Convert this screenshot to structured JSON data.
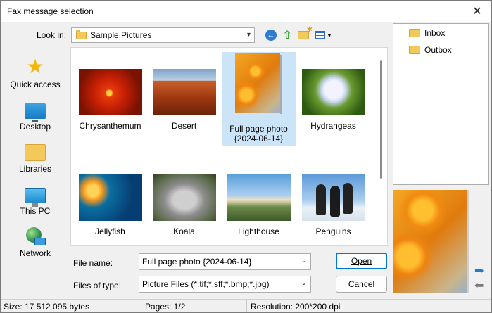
{
  "window": {
    "title": "Fax message selection"
  },
  "toolbar": {
    "look_in_label": "Look in:",
    "look_in_value": "Sample Pictures",
    "icons": [
      "back-icon",
      "up-folder-icon",
      "new-folder-icon",
      "views-menu-icon"
    ]
  },
  "places": [
    {
      "label": "Quick access",
      "icon": "star-icon"
    },
    {
      "label": "Desktop",
      "icon": "desktop-icon"
    },
    {
      "label": "Libraries",
      "icon": "libraries-icon"
    },
    {
      "label": "This PC",
      "icon": "this-pc-icon"
    },
    {
      "label": "Network",
      "icon": "network-icon"
    }
  ],
  "files": [
    {
      "label": "Chrysanthemum",
      "selected": false
    },
    {
      "label": "Desert",
      "selected": false
    },
    {
      "label": "Full page photo",
      "label2": "{2024-06-14}",
      "selected": true
    },
    {
      "label": "Hydrangeas",
      "selected": false
    },
    {
      "label": "Jellyfish",
      "selected": false
    },
    {
      "label": "Koala",
      "selected": false
    },
    {
      "label": "Lighthouse",
      "selected": false
    },
    {
      "label": "Penguins",
      "selected": false
    }
  ],
  "form": {
    "file_name_label": "File name:",
    "file_name_value": "Full page photo {2024-06-14}",
    "file_type_label": "Files of type:",
    "file_type_value": "Picture Files (*.tif;*.sff;*.bmp;*.jpg)",
    "open_label": "Open",
    "cancel_label": "Cancel"
  },
  "folders": [
    {
      "label": "Inbox"
    },
    {
      "label": "Outbox"
    }
  ],
  "status": {
    "size": "Size: 17 512 095 bytes",
    "pages": "Pages: 1/2",
    "resolution": "Resolution: 200*200 dpi"
  },
  "colors": {
    "selection": "#cce4f7",
    "accent": "#0078d4",
    "folder": "#f3c95a"
  }
}
